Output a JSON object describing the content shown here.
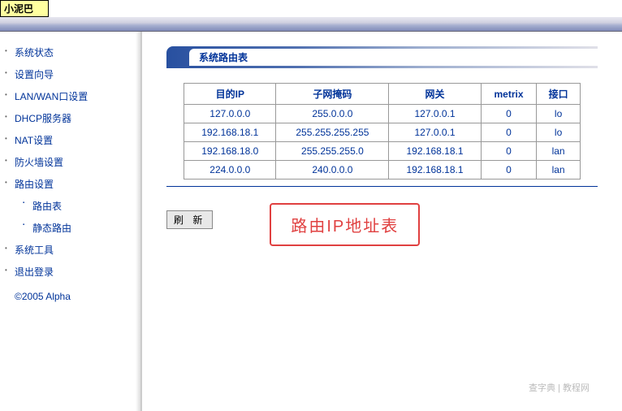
{
  "window_title": "小泥巴",
  "sidebar": {
    "items": [
      {
        "label": "系统状态"
      },
      {
        "label": "设置向导"
      },
      {
        "label": "LAN/WAN口设置"
      },
      {
        "label": "DHCP服务器"
      },
      {
        "label": "NAT设置"
      },
      {
        "label": "防火墙设置"
      },
      {
        "label": "路由设置",
        "children": [
          {
            "label": "路由表"
          },
          {
            "label": "静态路由"
          }
        ]
      },
      {
        "label": "系统工具"
      },
      {
        "label": "退出登录"
      }
    ],
    "copyright": "©2005 Alpha"
  },
  "main": {
    "section_title": "系统路由表",
    "table": {
      "headers": [
        "目的IP",
        "子网掩码",
        "网关",
        "metrix",
        "接口"
      ],
      "rows": [
        [
          "127.0.0.0",
          "255.0.0.0",
          "127.0.0.1",
          "0",
          "lo"
        ],
        [
          "192.168.18.1",
          "255.255.255.255",
          "127.0.0.1",
          "0",
          "lo"
        ],
        [
          "192.168.18.0",
          "255.255.255.0",
          "192.168.18.1",
          "0",
          "lan"
        ],
        [
          "224.0.0.0",
          "240.0.0.0",
          "192.168.18.1",
          "0",
          "lan"
        ]
      ]
    },
    "annotation": "路由IP地址表",
    "refresh_label": "刷 新"
  },
  "watermark": "查字典 | 教程网"
}
